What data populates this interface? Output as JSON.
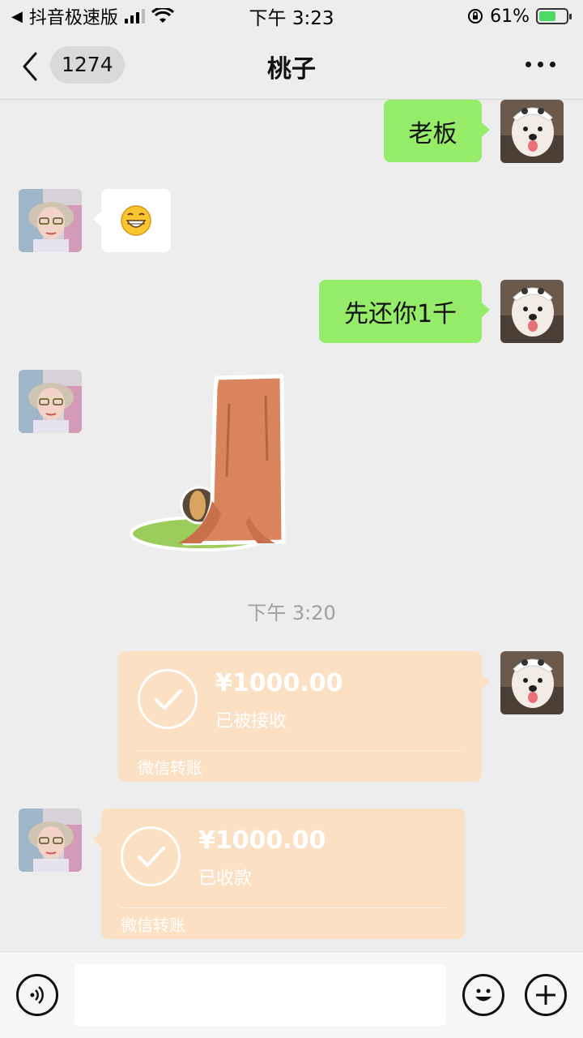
{
  "status_bar": {
    "back_app": "抖音极速版",
    "time": "下午 3:23",
    "battery_percent": "61%",
    "battery_level": 0.61
  },
  "nav": {
    "unread_count": "1274",
    "title": "桃子"
  },
  "messages": [
    {
      "side": "right",
      "type": "text",
      "text": "老板"
    },
    {
      "side": "left",
      "type": "emoji",
      "text": "😁"
    },
    {
      "side": "right",
      "type": "text",
      "text": "先还你1千"
    },
    {
      "side": "left",
      "type": "sticker",
      "icon": "tree-stump-sticker"
    }
  ],
  "timestamp": "下午 3:20",
  "transfers": [
    {
      "side": "right",
      "amount": "¥1000.00",
      "status": "已被接收",
      "label": "微信转账"
    },
    {
      "side": "left",
      "amount": "¥1000.00",
      "status": "已收款",
      "label": "微信转账"
    }
  ],
  "colors": {
    "bubble_self": "#95ec69",
    "bubble_other": "#ffffff",
    "transfer_bg": "#fbe0c3",
    "background": "#ededed"
  },
  "input_bar": {
    "voice_icon": "voice-icon",
    "emoji_icon": "emoji-icon",
    "plus_icon": "plus-icon"
  }
}
